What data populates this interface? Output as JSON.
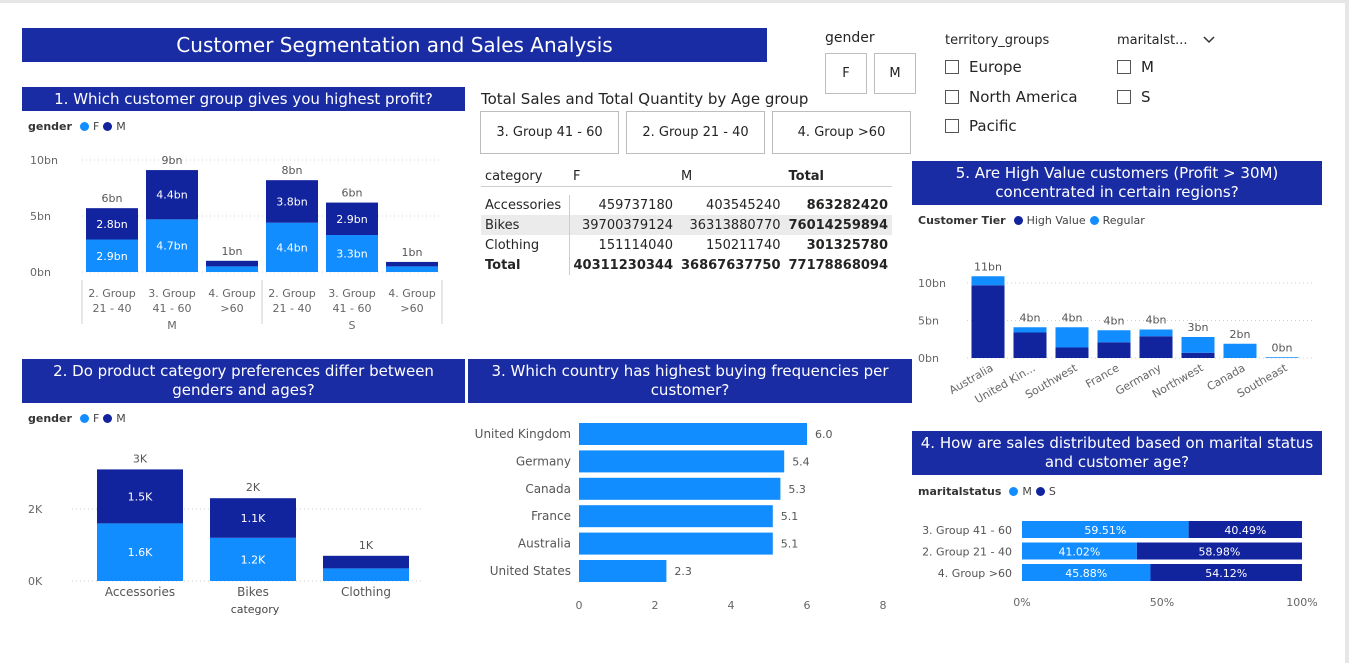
{
  "dashboard_title": "Customer Segmentation and Sales Analysis",
  "colors": {
    "banner": "#1a2ca3",
    "light_blue": "#118dff",
    "dark_blue": "#12239e"
  },
  "slicers": {
    "gender": {
      "title": "gender",
      "options": [
        "F",
        "M"
      ]
    },
    "territory": {
      "title": "territory_groups",
      "options": [
        "Europe",
        "North America",
        "Pacific"
      ]
    },
    "marital": {
      "title": "maritalst...",
      "options": [
        "M",
        "S"
      ],
      "icon": "chevron-down-icon"
    }
  },
  "q1": {
    "title": "1. Which customer group gives you highest profit?",
    "legend_title": "gender",
    "legend": [
      "F",
      "M"
    ],
    "chart_data": {
      "type": "bar",
      "stacked": true,
      "y_ticks": [
        "10bn",
        "5bn",
        "0bn"
      ],
      "ylim": [
        0,
        10
      ],
      "categories": [
        [
          "2. Group",
          "21 - 40"
        ],
        [
          "3. Group",
          "41 - 60"
        ],
        [
          "4. Group",
          ">60"
        ],
        [
          "2. Group",
          "21 - 40"
        ],
        [
          "3. Group",
          "41 - 60"
        ],
        [
          "4. Group",
          ">60"
        ]
      ],
      "group_labels": [
        "M",
        "S"
      ],
      "series": [
        {
          "name": "F",
          "values": [
            2.9,
            4.7,
            0.5,
            4.4,
            3.3,
            0.5
          ],
          "labels": [
            "2.9bn",
            "4.7bn",
            "",
            "4.4bn",
            "3.3bn",
            ""
          ]
        },
        {
          "name": "M",
          "values": [
            2.8,
            4.4,
            0.5,
            3.8,
            2.9,
            0.4
          ],
          "labels": [
            "2.8bn",
            "4.4bn",
            "",
            "3.8bn",
            "2.9bn",
            ""
          ]
        }
      ],
      "totals": [
        "6bn",
        "9bn",
        "1bn",
        "8bn",
        "6bn",
        "1bn"
      ]
    }
  },
  "age_filter": {
    "title": "Total Sales and Total Quantity by Age group",
    "buttons": [
      "3. Group 41 - 60",
      "2. Group 21 - 40",
      "4. Group >60"
    ]
  },
  "matrix": {
    "headers": [
      "category",
      "F",
      "M",
      "Total"
    ],
    "rows": [
      [
        "Accessories",
        "459737180",
        "403545240",
        "863282420"
      ],
      [
        "Bikes",
        "39700379124",
        "36313880770",
        "76014259894"
      ],
      [
        "Clothing",
        "151114040",
        "150211740",
        "301325780"
      ]
    ],
    "total_row": [
      "Total",
      "40311230344",
      "36867637750",
      "77178868094"
    ]
  },
  "q5": {
    "title": "5. Are High Value customers (Profit > 30M) concentrated in certain regions?",
    "legend_title": "Customer Tier",
    "legend": [
      "High Value",
      "Regular"
    ],
    "chart_data": {
      "type": "bar",
      "stacked": true,
      "y_ticks": [
        "10bn",
        "5bn",
        "0bn"
      ],
      "ylim": [
        0,
        12
      ],
      "categories": [
        "Australia",
        "United Kin...",
        "Southwest",
        "France",
        "Germany",
        "Northwest",
        "Canada",
        "Southeast"
      ],
      "series": [
        {
          "name": "High Value",
          "values": [
            9.7,
            3.4,
            1.4,
            2.1,
            2.9,
            0.7,
            0,
            0
          ]
        },
        {
          "name": "Regular",
          "values": [
            1.2,
            0.7,
            2.7,
            1.6,
            0.9,
            2.1,
            1.9,
            0.1
          ]
        }
      ],
      "totals": [
        "11bn",
        "4bn",
        "4bn",
        "4bn",
        "4bn",
        "3bn",
        "2bn",
        "0bn"
      ]
    }
  },
  "q2": {
    "title": "2. Do product category preferences differ between genders and ages?",
    "legend_title": "gender",
    "legend": [
      "F",
      "M"
    ],
    "chart_data": {
      "type": "bar",
      "stacked": true,
      "y_ticks": [
        "2K",
        "0K"
      ],
      "ylim": [
        0,
        3.5
      ],
      "xlabel": "category",
      "categories": [
        "Accessories",
        "Bikes",
        "Clothing"
      ],
      "series": [
        {
          "name": "F",
          "values": [
            1.6,
            1.2,
            0.35
          ],
          "labels": [
            "1.6K",
            "1.2K",
            ""
          ]
        },
        {
          "name": "M",
          "values": [
            1.5,
            1.1,
            0.35
          ],
          "labels": [
            "1.5K",
            "1.1K",
            ""
          ]
        }
      ],
      "totals": [
        "3K",
        "2K",
        "1K"
      ]
    }
  },
  "q3": {
    "title": "3. Which country has highest buying frequencies per customer?",
    "chart_data": {
      "type": "bar",
      "orientation": "horizontal",
      "categories": [
        "United Kingdom",
        "Germany",
        "Canada",
        "France",
        "Australia",
        "United States"
      ],
      "values": [
        6.0,
        5.4,
        5.3,
        5.1,
        5.1,
        2.3
      ],
      "labels": [
        "6.0",
        "5.4",
        "5.3",
        "5.1",
        "5.1",
        "2.3"
      ],
      "x_ticks": [
        "0",
        "2",
        "4",
        "6",
        "8"
      ],
      "xlim": [
        0,
        8
      ]
    }
  },
  "q4": {
    "title": "4. How are sales distributed based on marital status and customer age?",
    "legend_title": "maritalstatus",
    "legend": [
      "M",
      "S"
    ],
    "chart_data": {
      "type": "bar",
      "orientation": "horizontal",
      "stacked_percent": true,
      "categories": [
        "3. Group 41 - 60",
        "2. Group 21 - 40",
        "4. Group >60"
      ],
      "series": [
        {
          "name": "M",
          "values": [
            59.51,
            41.02,
            45.88
          ],
          "labels": [
            "59.51%",
            "41.02%",
            "45.88%"
          ]
        },
        {
          "name": "S",
          "values": [
            40.49,
            58.98,
            54.12
          ],
          "labels": [
            "40.49%",
            "58.98%",
            "54.12%"
          ]
        }
      ],
      "x_ticks": [
        "0%",
        "50%",
        "100%"
      ]
    }
  }
}
